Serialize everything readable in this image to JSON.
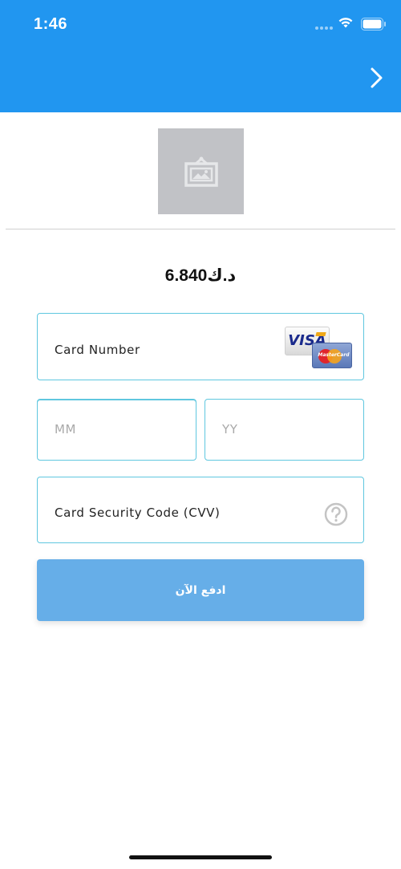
{
  "status_bar": {
    "time": "1:46"
  },
  "header": {
    "background_color": "#2196f0",
    "forward_icon": "chevron-right-icon"
  },
  "product": {
    "image_icon": "image-placeholder-icon"
  },
  "payment": {
    "amount": "6.840د.ك"
  },
  "form": {
    "card_number_label": "Card Number",
    "card_logos": {
      "visa_text": "VISA",
      "mastercard_text": "MasterCard"
    },
    "expiry_month_placeholder": "MM",
    "expiry_year_placeholder": "YY",
    "cvv_label": "Card Security Code (CVV)",
    "cvv_help_icon": "question-circle-icon",
    "border_color": "#5fc7df"
  },
  "pay_button": {
    "label": "ادفع الآن",
    "color": "#66aee8"
  }
}
